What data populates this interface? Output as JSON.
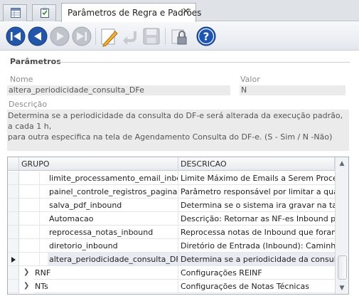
{
  "tabs": {
    "icon_tab_1": "grid-icon",
    "icon_tab_2": "checklist-icon",
    "active_title": "Parâmetros de Regra e Padrões",
    "close_glyph": "✕"
  },
  "toolbar": {
    "buttons": [
      "first-record-icon",
      "previous-record-icon",
      "next-record-icon",
      "last-record-icon",
      "edit-icon",
      "undo-icon",
      "save-icon",
      "lock-icon",
      "help-icon"
    ]
  },
  "params": {
    "section_title": "Parâmetros",
    "name_label": "Nome",
    "name_value": "altera_periodicidade_consulta_DFe",
    "value_label": "Valor",
    "value_value": "N",
    "desc_label": "Descrição",
    "desc_line1": "Determina se a periodicidade da consulta do DF-e será alterada da execução padrão, a cada 1 h,",
    "desc_line2": "para outra especifica na tela de Agendamento Consulta do DF-e. (S - Sim / N -Não)"
  },
  "grid": {
    "col_group": "GRUPO",
    "col_desc": "DESCRICAO",
    "rows": [
      {
        "name": "limite_processamento_email_inbound",
        "desc": "Limite Máximo de Emails a Serem Processa..."
      },
      {
        "name": "painel_controle_registros_paginac...",
        "desc": "Parâmetro responsável por limitar a quanti..."
      },
      {
        "name": "salva_pdf_inbound",
        "desc": "Determina se o sistema ira gravar na tabel..."
      },
      {
        "name": "Automacao",
        "desc": "Descrição: Retornar as NF-es Inbound par..."
      },
      {
        "name": "reprocessa_notas_inbound",
        "desc": "Reprocessa notas de Inbound que foram r..."
      },
      {
        "name": "diretorio_inbound",
        "desc": "Diretório de Entrada (Inbound): Caminho c..."
      },
      {
        "name": "altera_periodicidade_consulta_DFe",
        "desc": "Determina se a periodicidade da consulta ..."
      }
    ],
    "groups": [
      {
        "name": "RNF",
        "desc": "Configurações REINF"
      },
      {
        "name": "NTs",
        "desc": "Configurações de Notas Técnicas"
      }
    ]
  },
  "colors": {
    "accent": "#1a4f9c",
    "selection": "#e8ecf2"
  }
}
